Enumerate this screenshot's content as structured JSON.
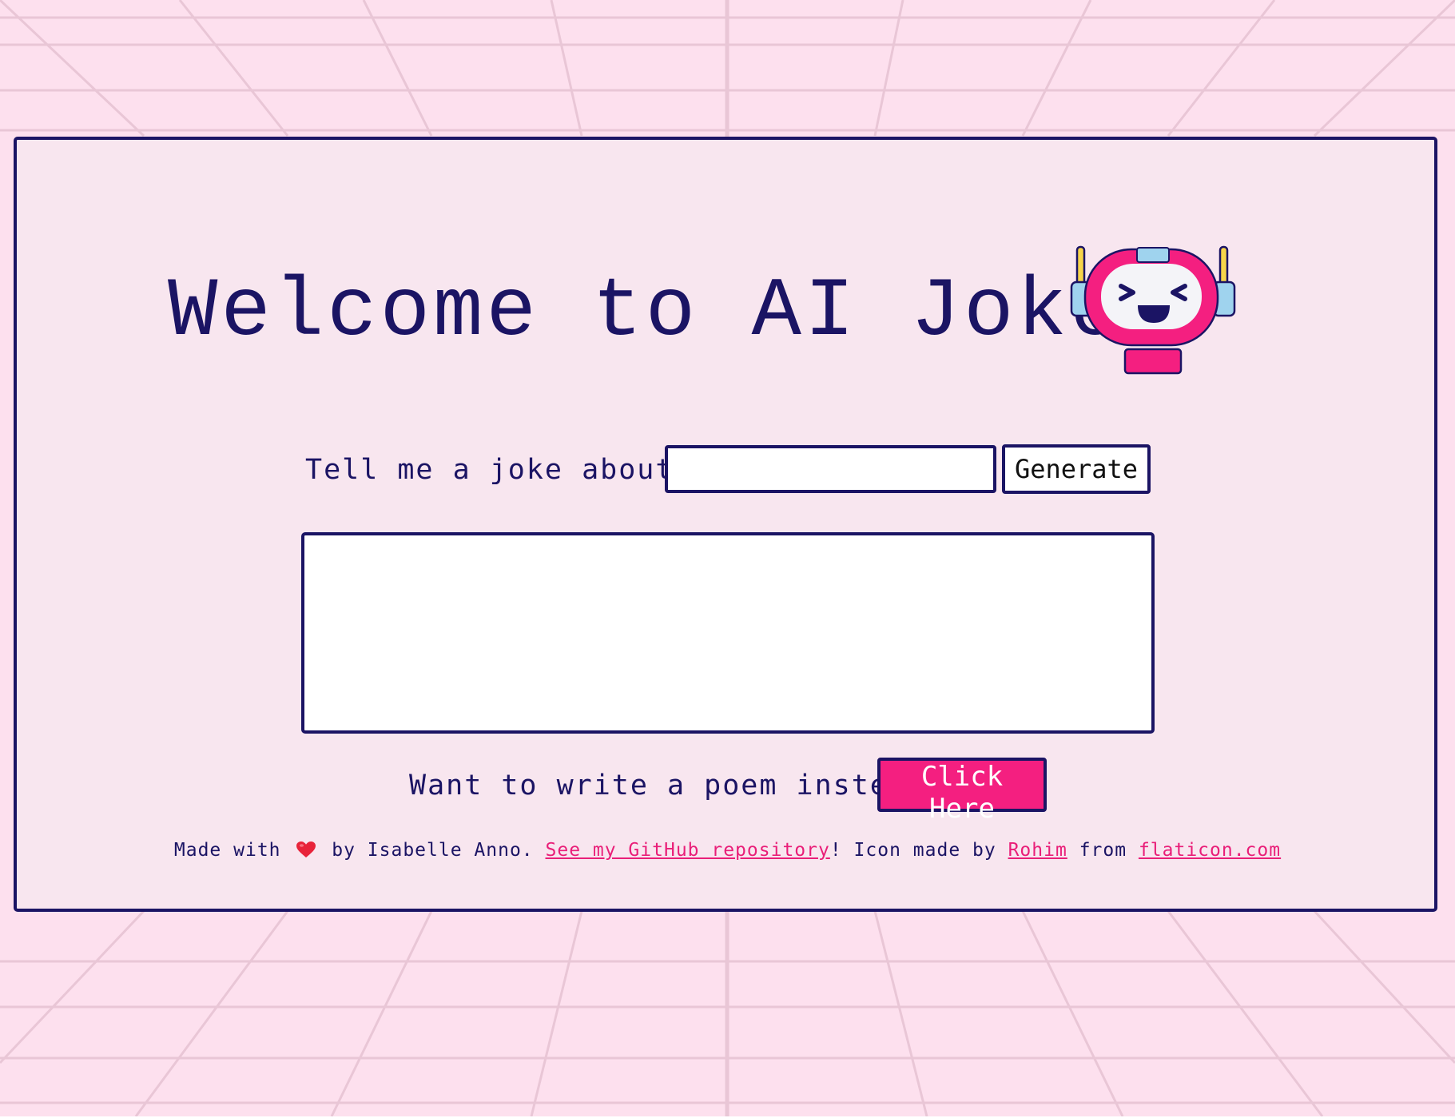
{
  "page": {
    "title": "Welcome to AI Jokes"
  },
  "joke_form": {
    "label": "Tell me a joke about...",
    "topic_value": "",
    "generate_label": "Generate"
  },
  "output": {
    "text": ""
  },
  "poem_prompt": {
    "label": "Want to write a poem instead?",
    "button_label": "Click Here"
  },
  "footer": {
    "made_with": "Made with",
    "by_author": "by Isabelle Anno.",
    "repo_link": "See my GitHub repository",
    "icon_credit": "! Icon made by",
    "icon_author_link": "Rohim",
    "from_text": "from",
    "flaticon_link": "flaticon.com"
  },
  "icons": {
    "heart": "heart-icon",
    "robot": "robot-mascot-icon"
  },
  "colors": {
    "background": "#fde0ee",
    "card": "#f8e6ef",
    "navy": "#1b1464",
    "accent": "#f41f80",
    "link": "#e91e78"
  }
}
